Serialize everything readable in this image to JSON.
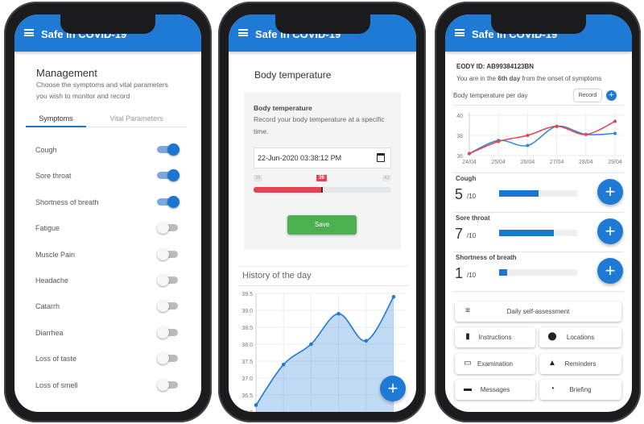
{
  "app_title": "Safe in COVID-19",
  "colors": {
    "primary": "#1f7ad6",
    "accent_red": "#e8414f",
    "save_green": "#4caf50"
  },
  "screen1": {
    "title": "Management",
    "description_line1": "Choose the symptoms and vital parameters",
    "description_line2": "you wish to monitor and record",
    "tabs": [
      {
        "label": "Symptoms",
        "active": true
      },
      {
        "label": "Vital Parameters",
        "active": false
      }
    ],
    "symptoms": [
      {
        "label": "Cough",
        "enabled": true
      },
      {
        "label": "Sore throat",
        "enabled": true
      },
      {
        "label": "Shortness of breath",
        "enabled": true
      },
      {
        "label": "Fatigue",
        "enabled": false
      },
      {
        "label": "Muscle Pain",
        "enabled": false
      },
      {
        "label": "Headache",
        "enabled": false
      },
      {
        "label": "Catarrh",
        "enabled": false
      },
      {
        "label": "Diarrhea",
        "enabled": false
      },
      {
        "label": "Loss of taste",
        "enabled": false
      },
      {
        "label": "Loss of smell",
        "enabled": false
      }
    ]
  },
  "screen2": {
    "title": "Body temperature",
    "card_title": "Body temperature",
    "card_desc_line1": "Record your body temperature at a specific",
    "card_desc_line2": "time.",
    "datetime_value": "22-Jun-2020 03:38:12 PM",
    "slider": {
      "min": "36",
      "max": "42",
      "value": "39",
      "min_value": 36,
      "max_value": 42,
      "current": 39
    },
    "save_label": "Save",
    "history_title": "History of the day",
    "fab_label": "+"
  },
  "chart_data": [
    {
      "type": "area",
      "title": "History of the day",
      "y_ticks": [
        "39.5",
        "39.0",
        "38.5",
        "38.0",
        "37.5",
        "37.0",
        "36.5",
        "36.0"
      ],
      "ylim": [
        36.0,
        39.5
      ],
      "grid": true,
      "series": [
        {
          "values": [
            36.2,
            37.4,
            38.0,
            38.9,
            38.1,
            39.4
          ],
          "color": "#1f7ad6"
        }
      ]
    },
    {
      "type": "line",
      "title": "Body temperature per day",
      "categories": [
        "24/04",
        "25/04",
        "26/04",
        "27/04",
        "28/04",
        "29/04"
      ],
      "y_ticks": [
        "40",
        "38",
        "36"
      ],
      "ylim": [
        36,
        40
      ],
      "grid": true,
      "series": [
        {
          "values": [
            36.2,
            37.5,
            37.0,
            38.9,
            38.1,
            38.2
          ],
          "color": "#2f86d8"
        },
        {
          "values": [
            36.2,
            37.4,
            38.0,
            38.9,
            38.1,
            39.4
          ],
          "color": "#e8414f"
        }
      ]
    }
  ],
  "screen3": {
    "eody_label": "EODY ID:",
    "eody_id": "AB99384123BN",
    "onset_prefix": "You are in the ",
    "onset_day": "6th day",
    "onset_suffix": " from the onset of symptoms",
    "chart_title": "Body temperature per day",
    "record_label": "Record",
    "symptoms": [
      {
        "label": "Cough",
        "score": "5",
        "max": "/10",
        "fraction": 0.5
      },
      {
        "label": "Sore throat",
        "score": "7",
        "max": "/10",
        "fraction": 0.7
      },
      {
        "label": "Shortness of breath",
        "score": "1",
        "max": "/10",
        "fraction": 0.1
      }
    ],
    "buttons": [
      {
        "label": "Daily self-assessment",
        "icon": "checklist-icon",
        "glyph": "≡"
      },
      {
        "label": "Instructions",
        "icon": "clipboard-icon",
        "glyph": "▮"
      },
      {
        "label": "Locations",
        "icon": "location-pin-icon",
        "glyph": "⬤"
      },
      {
        "label": "Examination",
        "icon": "folder-icon",
        "glyph": "▭"
      },
      {
        "label": "Reminders",
        "icon": "bell-icon",
        "glyph": "▲"
      },
      {
        "label": "Messages",
        "icon": "message-icon",
        "glyph": "▬"
      },
      {
        "label": "Briefing",
        "icon": "rss-feed-icon",
        "glyph": "◔"
      }
    ]
  }
}
